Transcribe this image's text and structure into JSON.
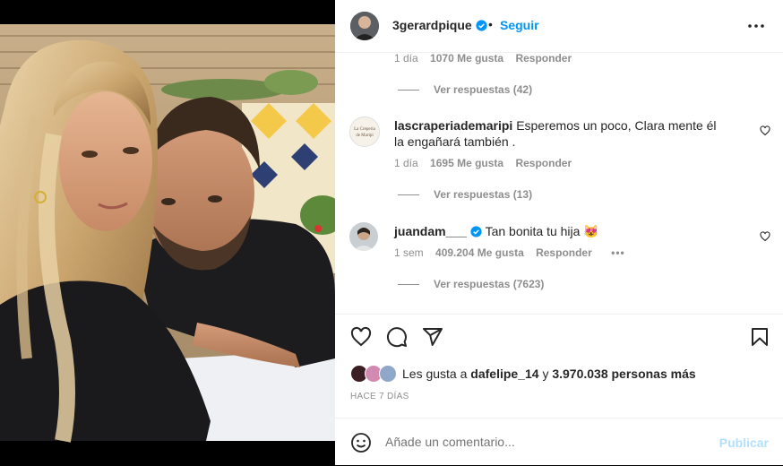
{
  "post": {
    "username": "3gerardpique",
    "dot": "•",
    "follow_label": "Seguir"
  },
  "comments": [
    {
      "username": "",
      "text": "",
      "time": "1 día",
      "likes": "1070 Me gusta",
      "reply_label": "Responder",
      "view_replies": "Ver respuestas (42)"
    },
    {
      "username": "lascraperiademaripi",
      "text": "Esperemos un poco, Clara mente él la engañará también .",
      "time": "1 día",
      "likes": "1695 Me gusta",
      "reply_label": "Responder",
      "view_replies": "Ver respuestas (13)",
      "avatar_text": "La Creperia de Maripi"
    },
    {
      "username": "juandam___",
      "text": "Tan bonita tu hija 😻",
      "time": "1 sem",
      "likes": "409.204 Me gusta",
      "reply_label": "Responder",
      "more": "•••",
      "view_replies": "Ver respuestas (7623)"
    }
  ],
  "likes_summary": {
    "prefix": "Les gusta a ",
    "user": "dafelipe_14",
    "middle": " y ",
    "count": "3.970.038 personas más"
  },
  "date": "HACE 7 DÍAS",
  "composer": {
    "placeholder": "Añade un comentario...",
    "publish_label": "Publicar"
  },
  "colors": {
    "accent": "#0095f6",
    "publish_disabled": "#b2dffc",
    "muted": "#8e8e8e",
    "text": "#262626"
  }
}
